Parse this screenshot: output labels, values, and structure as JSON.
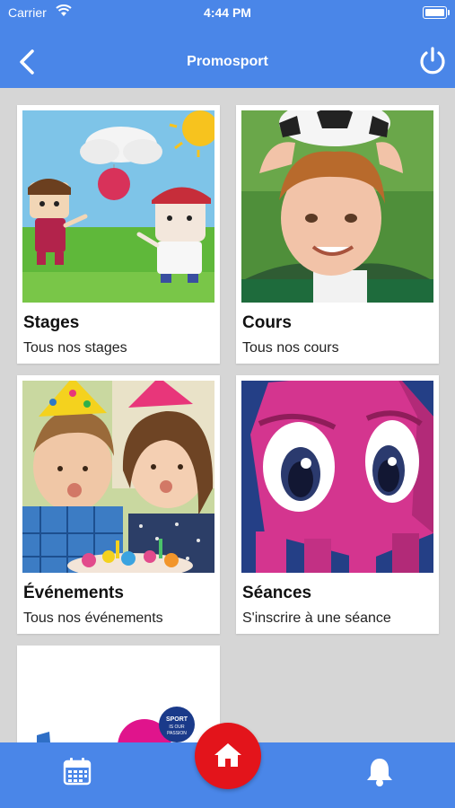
{
  "status_bar": {
    "carrier": "Carrier",
    "time": "4:44 PM"
  },
  "header": {
    "title": "Promosport"
  },
  "cards": [
    {
      "title": "Stages",
      "subtitle": "Tous nos stages"
    },
    {
      "title": "Cours",
      "subtitle": "Tous nos cours"
    },
    {
      "title": "Événements",
      "subtitle": "Tous nos événements"
    },
    {
      "title": "Séances",
      "subtitle": "S'inscrire à une séance"
    }
  ],
  "partial_card": {
    "logo_text": [
      "SPORT",
      "IS OUR",
      "PASSION"
    ]
  },
  "tabbar": {
    "items": [
      {
        "icon": "calendar-icon"
      },
      {
        "icon": "home-icon",
        "active": true
      },
      {
        "icon": "bell-icon"
      }
    ]
  },
  "colors": {
    "primary": "#4a86e8",
    "accent": "#e3141b",
    "background": "#d6d6d6"
  }
}
